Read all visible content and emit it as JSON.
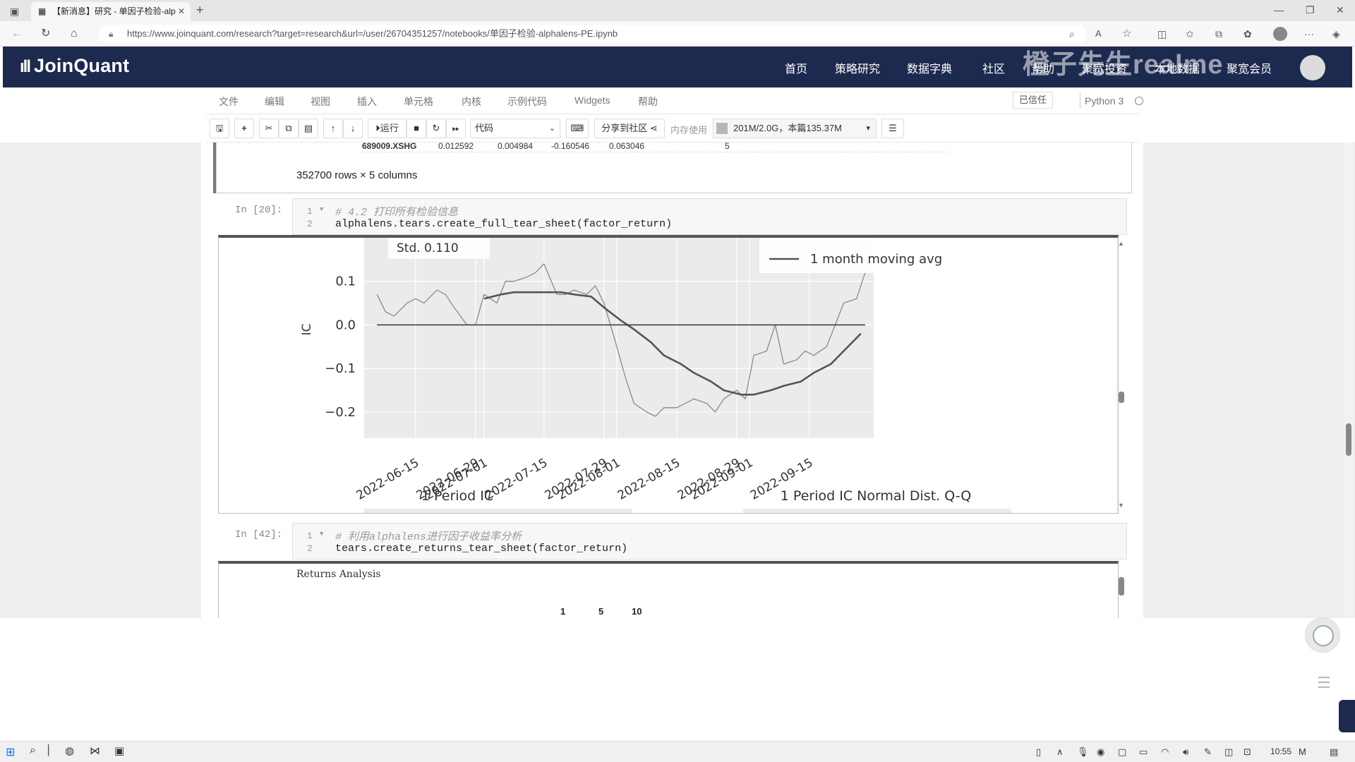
{
  "browser": {
    "tab_title": "【新消息】研究 - 单因子检验-alp",
    "url": "https://www.joinquant.com/research?target=research&url=/user/26704351257/notebooks/单因子检验-alphalens-PE.ipynb"
  },
  "header": {
    "logo": "JoinQuant",
    "nav": [
      "首页",
      "策略研究",
      "数据字典",
      "社区",
      "帮助",
      "聚宽投资",
      "本地数据",
      "聚宽会员"
    ],
    "watermark": "橙子先生realme"
  },
  "menubar": {
    "items": [
      "文件",
      "编辑",
      "视图",
      "插入",
      "单元格",
      "内核",
      "示例代码",
      "Widgets",
      "帮助"
    ],
    "trusted": "已信任",
    "kernel": "Python 3"
  },
  "toolbar": {
    "run_label": "运行",
    "cell_type": "代码",
    "share_label": "分享到社区",
    "memory_label": "内存使用",
    "memory_value": "201M/2.0G，本篇135.37M"
  },
  "cells": {
    "table_row": {
      "code": "689009.XSHG",
      "values": [
        "0.012592",
        "0.004984",
        "-0.160546",
        "0.063046",
        "5"
      ]
    },
    "table_summary": "352700 rows × 5 columns",
    "cell20": {
      "prompt": "In  [20]:",
      "line1": "# 4.2 打印所有检验信息",
      "line2": "alphalens.tears.create_full_tear_sheet(factor_return)"
    },
    "cell42": {
      "prompt": "In  [42]:",
      "line1": "# 利用alphalens进行因子收益率分析",
      "line2": "tears.create_returns_tear_sheet(factor_return)"
    },
    "returns_title": "Returns Analysis",
    "returns_cols": [
      "1",
      "5",
      "10"
    ]
  },
  "chart_data": {
    "type": "line",
    "ylabel": "IC",
    "ylim": [
      -0.26,
      0.2
    ],
    "yticks": [
      0.1,
      0.0,
      -0.1,
      -0.2
    ],
    "ytick_labels": [
      "0.1",
      "0.0",
      "−0.1",
      "−0.2"
    ],
    "xtick_labels": [
      "2022-06-15",
      "2022-06-29",
      "2022-07-01",
      "2022-07-15",
      "2022-07-29",
      "2022-08-01",
      "2022-08-15",
      "2022-08-29",
      "2022-09-01",
      "2022-09-15"
    ],
    "stats_text": "Std. 0.110",
    "legend_label": "1 month moving avg",
    "subplot_titles": [
      "1 Period IC",
      "1 Period IC Normal Dist. Q-Q"
    ],
    "series": [
      {
        "name": "IC",
        "x": [
          "2022-06-06",
          "2022-06-08",
          "2022-06-10",
          "2022-06-13",
          "2022-06-15",
          "2022-06-17",
          "2022-06-20",
          "2022-06-22",
          "2022-06-24",
          "2022-06-27",
          "2022-06-29",
          "2022-07-01",
          "2022-07-04",
          "2022-07-06",
          "2022-07-08",
          "2022-07-11",
          "2022-07-13",
          "2022-07-15",
          "2022-07-18",
          "2022-07-20",
          "2022-07-22",
          "2022-07-25",
          "2022-07-27",
          "2022-07-29",
          "2022-08-01",
          "2022-08-03",
          "2022-08-05",
          "2022-08-08",
          "2022-08-10",
          "2022-08-12",
          "2022-08-15",
          "2022-08-17",
          "2022-08-19",
          "2022-08-22",
          "2022-08-24",
          "2022-08-26",
          "2022-08-29",
          "2022-08-31",
          "2022-09-02",
          "2022-09-05",
          "2022-09-07",
          "2022-09-09",
          "2022-09-12",
          "2022-09-14",
          "2022-09-16",
          "2022-09-19",
          "2022-09-21",
          "2022-09-23",
          "2022-09-26",
          "2022-09-28"
        ],
        "values": [
          0.07,
          0.03,
          0.02,
          0.05,
          0.06,
          0.05,
          0.08,
          0.07,
          0.04,
          0.0,
          0.0,
          0.07,
          0.05,
          0.1,
          0.1,
          0.11,
          0.12,
          0.14,
          0.07,
          0.07,
          0.08,
          0.07,
          0.09,
          0.05,
          -0.05,
          -0.12,
          -0.18,
          -0.2,
          -0.21,
          -0.19,
          -0.19,
          -0.18,
          -0.17,
          -0.18,
          -0.2,
          -0.17,
          -0.15,
          -0.17,
          -0.07,
          -0.06,
          0.0,
          -0.09,
          -0.08,
          -0.06,
          -0.07,
          -0.05,
          0.0,
          0.05,
          0.06,
          0.12
        ]
      },
      {
        "name": "1 month moving avg",
        "x": [
          "2022-07-01",
          "2022-07-05",
          "2022-07-08",
          "2022-07-12",
          "2022-07-15",
          "2022-07-19",
          "2022-07-22",
          "2022-07-26",
          "2022-07-29",
          "2022-08-02",
          "2022-08-05",
          "2022-08-09",
          "2022-08-12",
          "2022-08-16",
          "2022-08-19",
          "2022-08-23",
          "2022-08-26",
          "2022-08-30",
          "2022-09-02",
          "2022-09-06",
          "2022-09-09",
          "2022-09-13",
          "2022-09-16",
          "2022-09-20",
          "2022-09-23",
          "2022-09-27"
        ],
        "values": [
          0.06,
          0.07,
          0.075,
          0.075,
          0.075,
          0.075,
          0.07,
          0.065,
          0.04,
          0.01,
          -0.01,
          -0.04,
          -0.07,
          -0.09,
          -0.11,
          -0.13,
          -0.15,
          -0.16,
          -0.16,
          -0.15,
          -0.14,
          -0.13,
          -0.11,
          -0.09,
          -0.06,
          -0.02
        ]
      },
      {
        "name": "zero",
        "x": [
          "2022-06-06",
          "2022-09-28"
        ],
        "values": [
          0.0,
          0.0
        ]
      }
    ]
  }
}
